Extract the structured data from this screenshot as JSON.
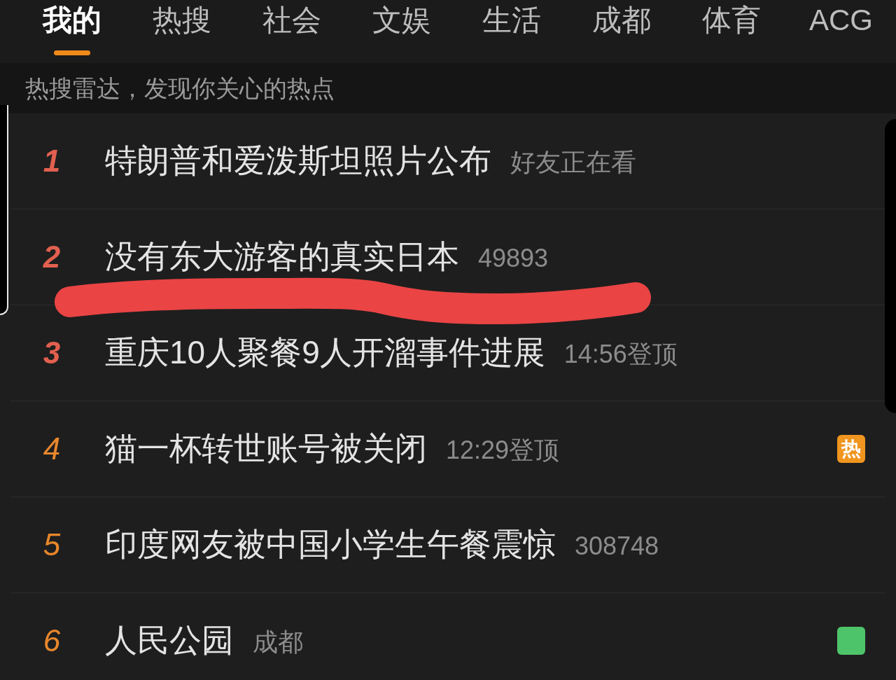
{
  "tabs": [
    {
      "label": "我的",
      "selected": true
    },
    {
      "label": "热搜",
      "selected": false
    },
    {
      "label": "社会",
      "selected": false
    },
    {
      "label": "文娱",
      "selected": false
    },
    {
      "label": "生活",
      "selected": false
    },
    {
      "label": "成都",
      "selected": false
    },
    {
      "label": "体育",
      "selected": false
    },
    {
      "label": "ACG",
      "selected": false
    }
  ],
  "hint": "热搜雷达，发现你关心的热点",
  "items": [
    {
      "rank": "1",
      "kind": "top",
      "color": "#e2604f",
      "title": "特朗普和爱泼斯坦照片公布",
      "meta": "好友正在看",
      "marked": false
    },
    {
      "rank": "2",
      "kind": "top",
      "color": "#e2604f",
      "title": "没有东大游客的真实日本",
      "meta": "49893",
      "marked": true
    },
    {
      "rank": "3",
      "kind": "top",
      "color": "#e2604f",
      "title": "重庆10人聚餐9人开溜事件进展",
      "meta": "14:56登顶",
      "marked": false
    },
    {
      "rank": "4",
      "kind": "normal",
      "color": "#e8872c",
      "title": "猫一杯转世账号被关闭",
      "meta": "12:29登顶",
      "marked": false,
      "badge": {
        "kind": "label",
        "text": "热",
        "color": "#f0951f"
      }
    },
    {
      "rank": "5",
      "kind": "normal",
      "color": "#e8872c",
      "title": "印度网友被中国小学生午餐震惊",
      "meta": "308748",
      "marked": false
    },
    {
      "rank": "6",
      "kind": "normal",
      "color": "#e8872c",
      "title": "人民公园",
      "meta": "成都",
      "marked": false,
      "badge": {
        "kind": "tile",
        "color": "#4ec46a"
      }
    }
  ]
}
